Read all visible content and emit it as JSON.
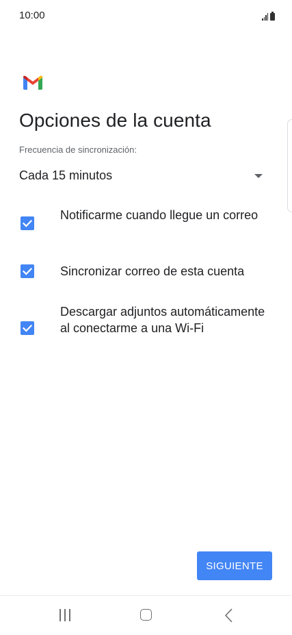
{
  "status_bar": {
    "time": "10:00",
    "signal_icon": "signal-bars-icon",
    "battery_icon": "battery-icon"
  },
  "app_logo": "gmail-logo",
  "page_title": "Opciones de la cuenta",
  "sync_frequency": {
    "label": "Frecuencia de sincronización:",
    "selected": "Cada 15 minutos",
    "icon": "dropdown-arrow-icon"
  },
  "options": [
    {
      "label": "Notificarme cuando llegue un correo",
      "checked": true
    },
    {
      "label": "Sincronizar correo de esta cuenta",
      "checked": true
    },
    {
      "label": "Descargar adjuntos automáticamente al conectarme a una Wi-Fi",
      "checked": true
    }
  ],
  "next_button": {
    "label": "SIGUIENTE"
  },
  "nav_bar": {
    "recents_icon": "recents-icon",
    "home_icon": "home-icon",
    "back_icon": "back-icon"
  },
  "colors": {
    "accent": "#4285f4",
    "text_primary": "#202124",
    "text_secondary": "#5f6368"
  }
}
